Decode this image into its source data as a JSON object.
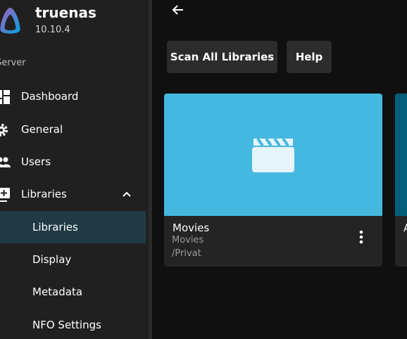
{
  "server": {
    "name": "truenas",
    "version": "10.10.4"
  },
  "sidebar": {
    "section_header": "Server",
    "items": [
      {
        "label": "Dashboard",
        "icon": "dashboard-icon"
      },
      {
        "label": "General",
        "icon": "gear-icon"
      },
      {
        "label": "Users",
        "icon": "users-icon"
      },
      {
        "label": "Libraries",
        "icon": "library-add-icon",
        "expanded": true
      }
    ],
    "sub_items": [
      {
        "label": "Libraries",
        "active": true
      },
      {
        "label": "Display"
      },
      {
        "label": "Metadata"
      },
      {
        "label": "NFO Settings"
      }
    ]
  },
  "toolbar": {
    "scan_label": "Scan All Libraries",
    "help_label": "Help"
  },
  "libraries": [
    {
      "title": "Movies",
      "type": "Movies",
      "path": "/Privat",
      "icon": "movie-clapper-icon",
      "color": "#45b8e0"
    },
    {
      "title": "A",
      "color": "#045f7a"
    }
  ],
  "colors": {
    "accent": "#45b8e0",
    "active_nav_bg": "#1f3a45",
    "sidebar_bg": "#202020",
    "page_bg": "#101010"
  }
}
